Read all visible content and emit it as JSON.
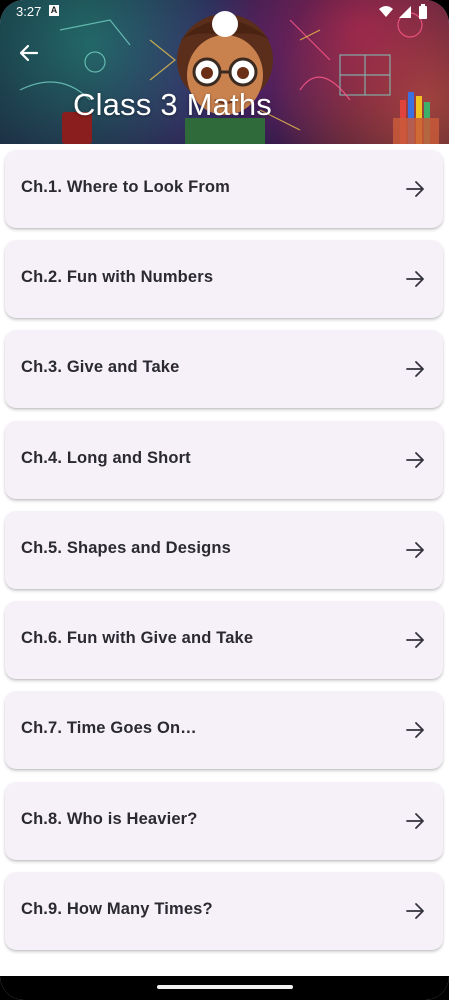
{
  "status_bar": {
    "time": "3:27",
    "notification_badge": "A"
  },
  "header": {
    "title": "Class 3 Maths"
  },
  "icons": {
    "back": "arrow-left-icon",
    "item": "arrow-right-icon"
  },
  "chapters": [
    {
      "label": "Ch.1. Where to Look From"
    },
    {
      "label": "Ch.2. Fun with Numbers"
    },
    {
      "label": "Ch.3. Give and Take"
    },
    {
      "label": "Ch.4. Long and Short"
    },
    {
      "label": "Ch.5. Shapes and Designs"
    },
    {
      "label": "Ch.6. Fun with Give and Take"
    },
    {
      "label": "Ch.7. Time Goes On…"
    },
    {
      "label": "Ch.8. Who is Heavier?"
    },
    {
      "label": "Ch.9. How Many Times?"
    }
  ],
  "colors": {
    "card_background": "#f6f1f9",
    "card_text": "#2a2a30"
  }
}
